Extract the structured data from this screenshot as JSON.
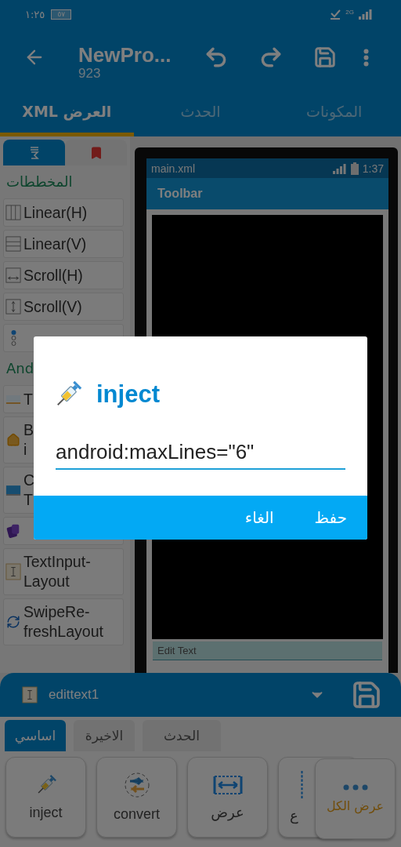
{
  "status_bar": {
    "time": "١:٢٥",
    "battery": "٥٧",
    "network": "2G"
  },
  "app_bar": {
    "title": "NewPro...",
    "subtitle": "923"
  },
  "tabs": [
    {
      "label": "المكونات",
      "selected": false
    },
    {
      "label": "الحدث",
      "selected": false
    },
    {
      "label": "العرض XML",
      "selected": true
    }
  ],
  "palette": {
    "tabs": [
      {
        "kind": "widgets",
        "selected": true
      },
      {
        "kind": "bookmarks",
        "selected": false
      }
    ],
    "sections": [
      {
        "title": "المخططات",
        "items": [
          {
            "kind": "linear-h",
            "lines": [
              "Linear(H)"
            ]
          },
          {
            "kind": "linear-v",
            "lines": [
              "Linear(V)"
            ]
          },
          {
            "kind": "scroll-h",
            "lines": [
              "Scroll(H)"
            ]
          },
          {
            "kind": "scroll-v",
            "lines": [
              "Scroll(V)"
            ]
          },
          {
            "kind": "radio"
          }
        ]
      },
      {
        "title": "And",
        "items": [
          {
            "kind": "tab",
            "lines": [
              "T"
            ]
          },
          {
            "kind": "home",
            "lines": [
              "B",
              "i"
            ]
          },
          {
            "kind": "screen",
            "lines": [
              "C",
              "T"
            ]
          },
          {
            "kind": "card"
          },
          {
            "kind": "text-input",
            "lines": [
              "TextInput-",
              "Layout"
            ]
          },
          {
            "kind": "refresh",
            "lines": [
              "SwipeRe-",
              "freshLayout"
            ]
          }
        ]
      }
    ]
  },
  "preview": {
    "file": "main.xml",
    "time": "1:37",
    "toolbar": "Toolbar",
    "field": {
      "placeholder": "Edit Text"
    }
  },
  "dialog": {
    "title": "inject",
    "value": "android:maxLines=\"6\"",
    "buttons": [
      "حفظ",
      "الغاء"
    ]
  },
  "bottom_sheet": {
    "component": "edittext1",
    "tabs": [
      {
        "label": "الحدث",
        "selected": false
      },
      {
        "label": "الاخيرة",
        "selected": false
      },
      {
        "label": "اساسي",
        "selected": true
      }
    ],
    "actions": [
      {
        "kind": "height",
        "label": "ع"
      },
      {
        "kind": "width",
        "label": "عرض"
      },
      {
        "kind": "convert",
        "label": "convert"
      },
      {
        "kind": "inject",
        "label": "inject"
      }
    ],
    "show_all": "عرض الكل"
  }
}
